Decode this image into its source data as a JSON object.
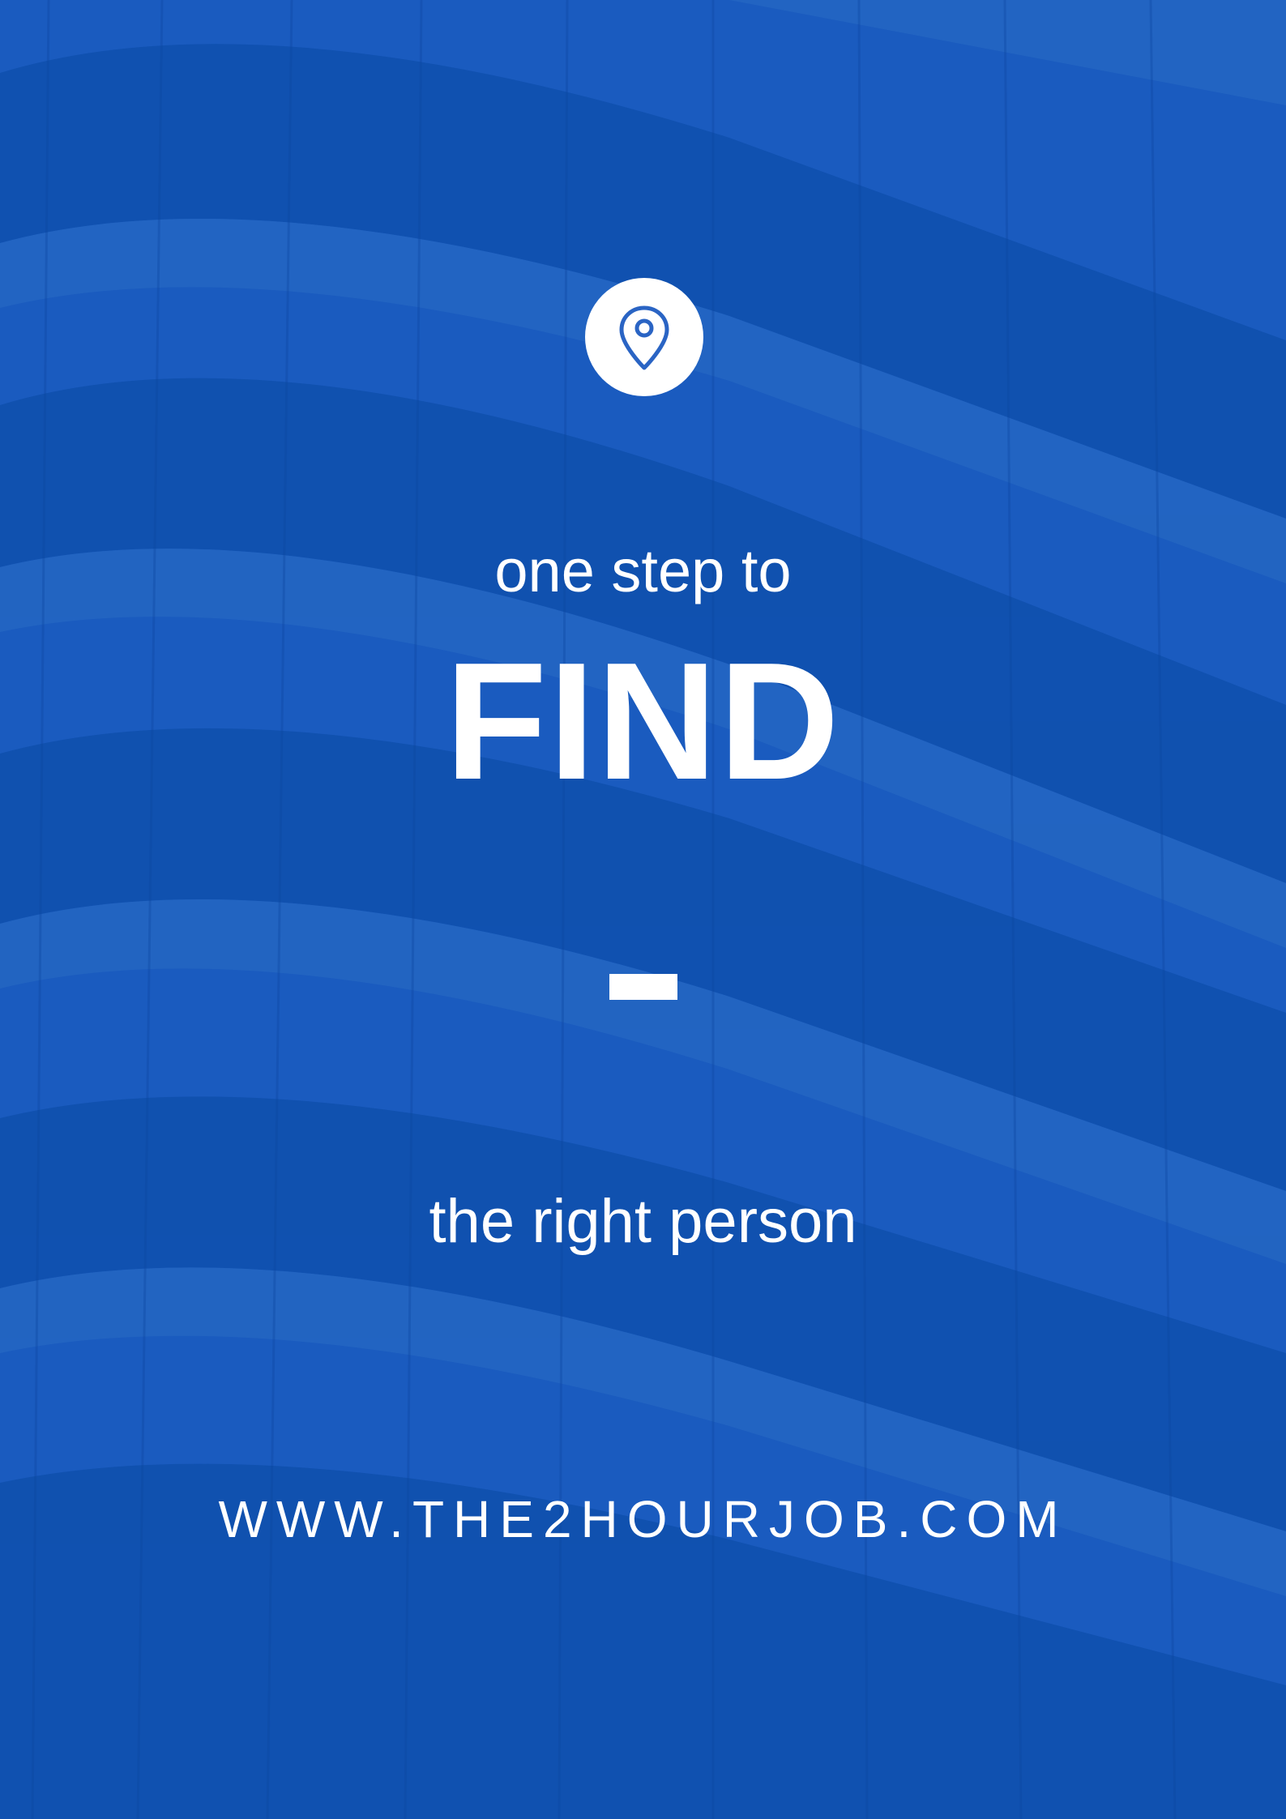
{
  "poster": {
    "intro_text": "one step to",
    "headline": "FIND",
    "tagline": "the right person",
    "website": "WWW.THE2HOURJOB.COM"
  },
  "icons": {
    "location": "map-pin-icon"
  },
  "colors": {
    "background": "#1a5bbf",
    "band_light": "#2a6ac4",
    "glass_dark": "#0f4aa8",
    "text": "#ffffff",
    "icon_circle": "#ffffff",
    "icon_stroke": "#2a64c4"
  }
}
